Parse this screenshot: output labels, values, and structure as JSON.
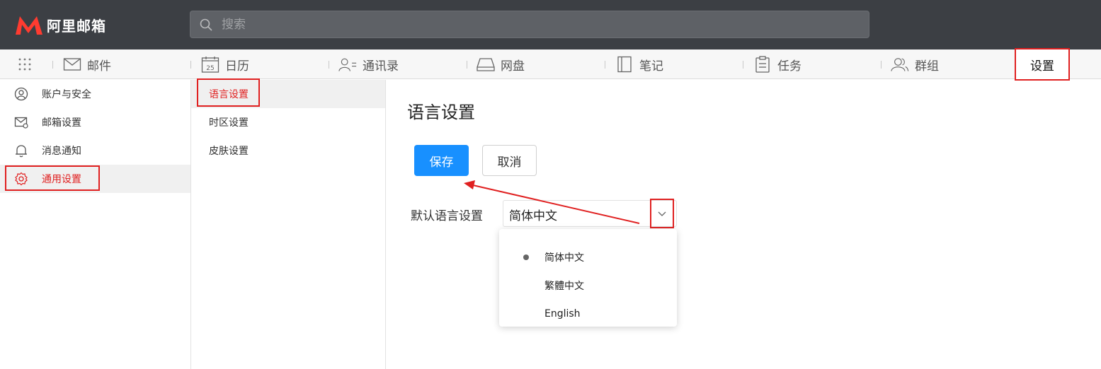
{
  "app": {
    "logo_text": "阿里邮箱"
  },
  "search": {
    "placeholder": "搜索"
  },
  "nav": {
    "items": [
      {
        "label": "邮件",
        "icon": "mail-icon"
      },
      {
        "label": "日历",
        "icon": "calendar-icon",
        "calendar_day": "25"
      },
      {
        "label": "通讯录",
        "icon": "contacts-icon"
      },
      {
        "label": "网盘",
        "icon": "drive-icon"
      },
      {
        "label": "笔记",
        "icon": "notes-icon"
      },
      {
        "label": "任务",
        "icon": "tasks-icon"
      },
      {
        "label": "群组",
        "icon": "group-icon"
      }
    ],
    "settings_label": "设置"
  },
  "sidebar": {
    "items": [
      {
        "label": "账户与安全",
        "icon": "user-icon"
      },
      {
        "label": "邮箱设置",
        "icon": "mail-settings-icon"
      },
      {
        "label": "消息通知",
        "icon": "bell-icon"
      },
      {
        "label": "通用设置",
        "icon": "gear-icon"
      }
    ],
    "active_index": 3
  },
  "subnav": {
    "items": [
      {
        "label": "语言设置"
      },
      {
        "label": "时区设置"
      },
      {
        "label": "皮肤设置"
      }
    ],
    "active_index": 0
  },
  "main": {
    "title": "语言设置",
    "save_label": "保存",
    "cancel_label": "取消",
    "lang_label": "默认语言设置",
    "lang_value": "简体中文",
    "options": [
      {
        "label": "简体中文",
        "selected": true
      },
      {
        "label": "繁體中文",
        "selected": false
      },
      {
        "label": "English",
        "selected": false
      }
    ]
  },
  "colors": {
    "topbar_bg": "#3c3f44",
    "brand_red": "#e02020",
    "primary_blue": "#1890ff",
    "annotation_red": "#e02020"
  }
}
